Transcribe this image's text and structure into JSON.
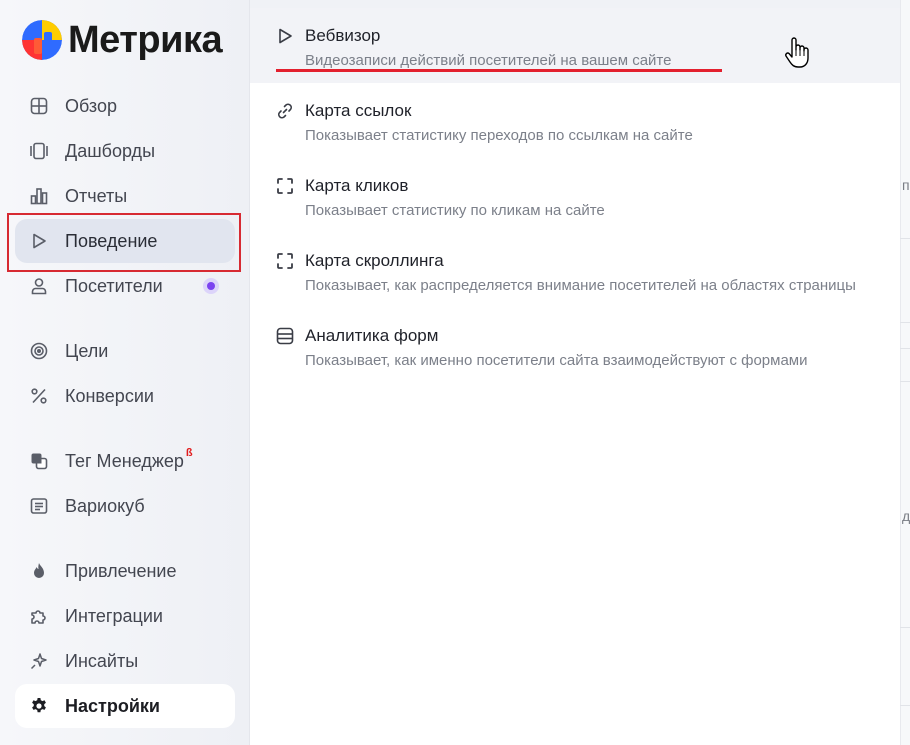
{
  "brand": {
    "name": "Метрика"
  },
  "sidebar": {
    "items": [
      {
        "label": "Обзор",
        "icon": "grid-icon"
      },
      {
        "label": "Дашборды",
        "icon": "dashboards-icon"
      },
      {
        "label": "Отчеты",
        "icon": "bar-chart-icon"
      },
      {
        "label": "Поведение",
        "icon": "play-icon",
        "active": true
      },
      {
        "label": "Посетители",
        "icon": "user-icon"
      },
      {
        "label": "Цели",
        "icon": "target-icon"
      },
      {
        "label": "Конверсии",
        "icon": "percent-icon"
      },
      {
        "label": "Тег Менеджер",
        "icon": "tag-manager-icon",
        "badge": "ß"
      },
      {
        "label": "Вариокуб",
        "icon": "variocube-icon"
      },
      {
        "label": "Привлечение",
        "icon": "flame-icon"
      },
      {
        "label": "Интеграции",
        "icon": "puzzle-icon"
      },
      {
        "label": "Инсайты",
        "icon": "sparkle-icon"
      },
      {
        "label": "Настройки",
        "icon": "gear-icon"
      }
    ]
  },
  "behavior_menu": {
    "items": [
      {
        "title": "Вебвизор",
        "description": "Видеозаписи действий посетителей на вашем сайте",
        "icon": "play-icon"
      },
      {
        "title": "Карта ссылок",
        "description": "Показывает статистику переходов по ссылкам на сайте",
        "icon": "link-icon"
      },
      {
        "title": "Карта кликов",
        "description": "Показывает статистику по кликам на сайте",
        "icon": "click-map-icon"
      },
      {
        "title": "Карта скроллинга",
        "description": "Показывает, как распределяется внимание посетителей на областях страницы",
        "icon": "scroll-map-icon"
      },
      {
        "title": "Аналитика форм",
        "description": "Показывает, как именно посетители сайта взаимодействуют с формами",
        "icon": "forms-icon"
      }
    ]
  },
  "edge_glyphs": [
    "п",
    "д"
  ],
  "colors": {
    "accent_red": "#e3202e",
    "badge_purple": "#7b42f0",
    "active_bg": "#e1e5ef"
  }
}
